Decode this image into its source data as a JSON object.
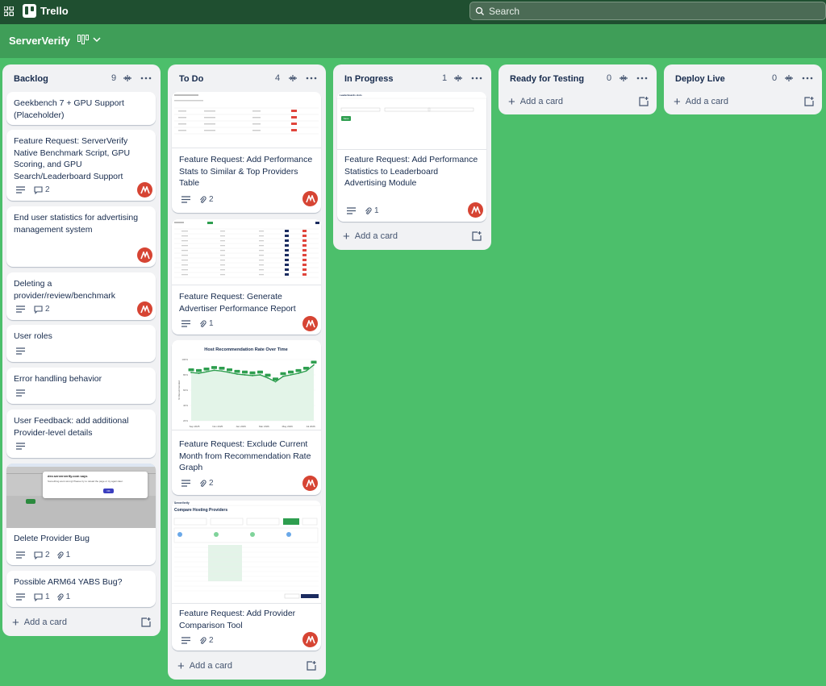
{
  "app": {
    "name": "Trello"
  },
  "search": {
    "placeholder": "Search"
  },
  "board": {
    "title": "ServerVerify"
  },
  "lists": [
    {
      "title": "Backlog",
      "count": "9",
      "cards": [
        {
          "title": "Geekbench 7 + GPU Support (Placeholder)"
        },
        {
          "title": "Feature Request: ServerVerify Native Benchmark Script, GPU Scoring, and GPU Search/Leaderboard Support",
          "comments": "2"
        },
        {
          "title": "End user statistics for advertising management system"
        },
        {
          "title": "Deleting a provider/review/benchmark",
          "comments": "2"
        },
        {
          "title": "User roles"
        },
        {
          "title": "Error handling behavior"
        },
        {
          "title": "User Feedback: add additional Provider-level details"
        },
        {
          "title": "Delete Provider Bug",
          "comments": "2",
          "attachments": "1",
          "cover": {
            "dialog_title": "dev.serververify.com says",
            "dialog_text": "Something went wrong! Please try to reload the page or try again later.",
            "dialog_button": "OK"
          }
        },
        {
          "title": "Possible ARM64 YABS Bug?",
          "comments": "1",
          "attachments": "1"
        }
      ],
      "add_card": "Add a card"
    },
    {
      "title": "To Do",
      "count": "4",
      "cards": [
        {
          "title": "Feature Request: Add Performance Stats to Similar & Top Providers Table",
          "attachments": "2"
        },
        {
          "title": "Feature Request: Generate Advertiser Performance Report",
          "attachments": "1"
        },
        {
          "title": "Feature Request: Exclude Current Month from Recommendation Rate Graph",
          "attachments": "2"
        },
        {
          "title": "Feature Request: Add Provider Comparison Tool",
          "attachments": "2",
          "cover": {
            "app_name": "ServerVerify",
            "page_title": "Compare Hosting Providers"
          }
        }
      ],
      "add_card": "Add a card"
    },
    {
      "title": "In Progress",
      "count": "1",
      "cards": [
        {
          "title": "Feature Request: Add Performance Statistics to Leaderboard Advertising Module",
          "attachments": "1",
          "cover": {
            "header": "Leaderboards slots",
            "button": "Save"
          }
        }
      ],
      "add_card": "Add a card"
    },
    {
      "title": "Ready for Testing",
      "count": "0",
      "cards": [],
      "add_card": "Add a card"
    },
    {
      "title": "Deploy Live",
      "count": "0",
      "cards": [],
      "add_card": "Add a card"
    }
  ],
  "chart_data": {
    "type": "line",
    "title": "Host Recommendation Rate Over Time",
    "ylabel": "% Recommended",
    "x": [
      "Sep 2025",
      "Nov 2025",
      "Jan 2026",
      "Mar 2026",
      "May 2026",
      "Jul 2026"
    ],
    "y_ticks": [
      "100%",
      "80%",
      "60%",
      "40%",
      "20%"
    ],
    "ylim": [
      20,
      100
    ],
    "series": [
      {
        "values": [
          83,
          82,
          84,
          86,
          85,
          83,
          81,
          80,
          79,
          80,
          76,
          71,
          78,
          80,
          82,
          85,
          93
        ]
      }
    ],
    "colors": {
      "line": "#2e9e4f",
      "fill": "#e3f4e8"
    }
  },
  "colors": {
    "topbar": "#1f4f30",
    "boardbar": "#3f9e58",
    "board": "#4cbf6b",
    "avatar": "#d64433"
  }
}
